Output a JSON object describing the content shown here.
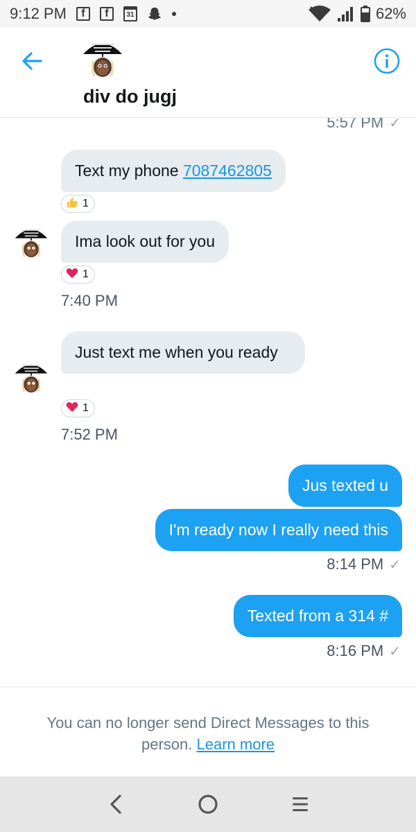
{
  "status_bar": {
    "time": "9:12 PM",
    "calendar_day": "31",
    "battery": "62%",
    "icons": [
      "facebook-icon",
      "facebook-icon",
      "calendar-icon",
      "snapchat-icon",
      "dot-icon",
      "wifi-icon",
      "signal-icon",
      "battery-icon"
    ]
  },
  "header": {
    "title": "div do jugj",
    "back_icon": "back-arrow-icon",
    "info_icon": "info-icon"
  },
  "colors": {
    "accent": "#1da1f2",
    "incoming_bubble": "#e6ecf0",
    "heart": "#e0245e"
  },
  "messages": {
    "cutoff_time": "5:57 PM",
    "m1": {
      "text_prefix": "Text my phone ",
      "phone": "7087462805",
      "reaction_icon": "thumbs-up-icon",
      "reaction_count": "1"
    },
    "m2": {
      "text": "Ima look out for you",
      "reaction_icon": "heart-icon",
      "reaction_count": "1",
      "time": "7:40 PM"
    },
    "m3": {
      "text": "Just text me when you ready",
      "reaction_icon": "heart-icon",
      "reaction_count": "1",
      "time": "7:52 PM"
    },
    "m4": {
      "text": "Jus texted u"
    },
    "m5": {
      "text": "I'm ready now I really need this",
      "time": "8:14 PM"
    },
    "m6": {
      "text": "Texted from a 314 #",
      "time": "8:16 PM"
    }
  },
  "footer": {
    "notice": "You can no longer send Direct Messages to this person.",
    "learn_more": "Learn more"
  }
}
